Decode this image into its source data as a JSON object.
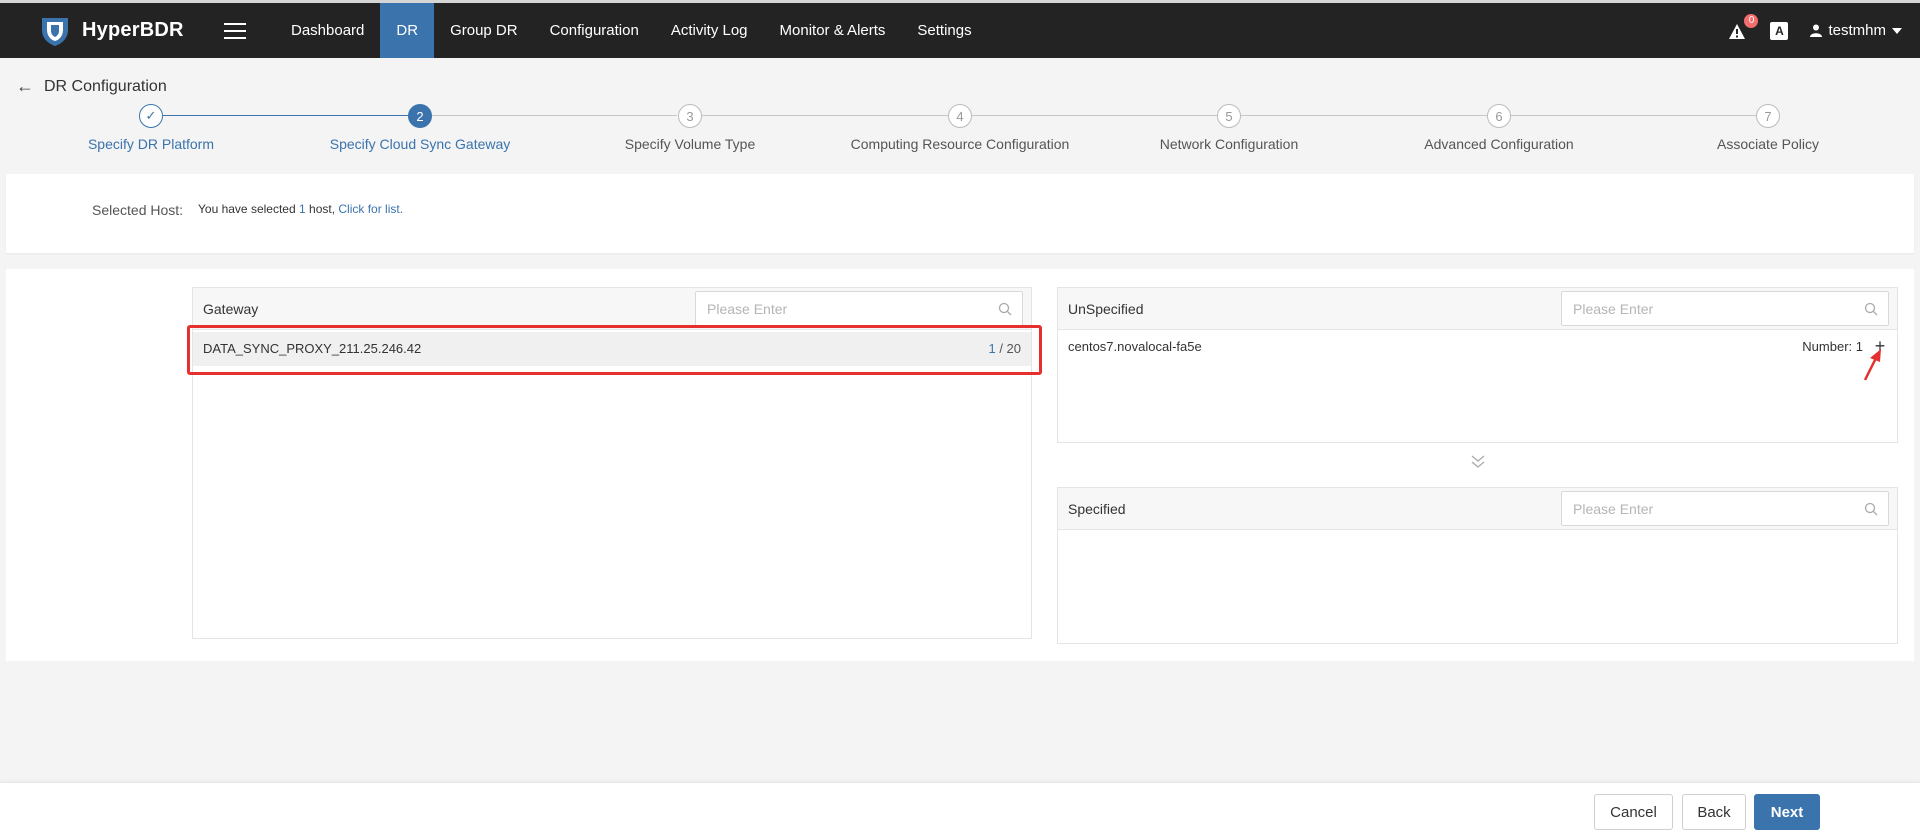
{
  "app": {
    "name": "HyperBDR"
  },
  "nav": {
    "items": [
      {
        "label": "Dashboard",
        "active": false
      },
      {
        "label": "DR",
        "active": true
      },
      {
        "label": "Group DR",
        "active": false
      },
      {
        "label": "Configuration",
        "active": false
      },
      {
        "label": "Activity Log",
        "active": false
      },
      {
        "label": "Monitor & Alerts",
        "active": false
      },
      {
        "label": "Settings",
        "active": false
      }
    ],
    "alert_count": "0",
    "lang_icon": "A",
    "user": "testmhm"
  },
  "page": {
    "title": "DR Configuration"
  },
  "stepper": {
    "steps": [
      {
        "num": "1",
        "label": "Specify DR Platform",
        "state": "done"
      },
      {
        "num": "2",
        "label": "Specify Cloud Sync Gateway",
        "state": "active"
      },
      {
        "num": "3",
        "label": "Specify Volume Type",
        "state": "pending"
      },
      {
        "num": "4",
        "label": "Computing Resource Configuration",
        "state": "pending"
      },
      {
        "num": "5",
        "label": "Network Configuration",
        "state": "pending"
      },
      {
        "num": "6",
        "label": "Advanced Configuration",
        "state": "pending"
      },
      {
        "num": "7",
        "label": "Associate Policy",
        "state": "pending"
      }
    ]
  },
  "selected_host": {
    "label": "Selected Host:",
    "prefix": "You have selected",
    "count": "1",
    "suffix": "host,",
    "link": "Click for list."
  },
  "gateway_panel": {
    "title": "Gateway",
    "search_placeholder": "Please Enter",
    "rows": [
      {
        "name": "DATA_SYNC_PROXY_211.25.246.42",
        "used": "1",
        "total": "/ 20"
      }
    ]
  },
  "unspecified_panel": {
    "title": "UnSpecified",
    "search_placeholder": "Please Enter",
    "rows": [
      {
        "name": "centos7.novalocal-fa5e",
        "number": "Number: 1",
        "action": "+"
      }
    ]
  },
  "specified_panel": {
    "title": "Specified",
    "search_placeholder": "Please Enter"
  },
  "footer": {
    "cancel": "Cancel",
    "back": "Back",
    "next": "Next"
  },
  "colors": {
    "accent": "#3b73ad",
    "topbar": "#232323",
    "highlight": "#e53030"
  }
}
